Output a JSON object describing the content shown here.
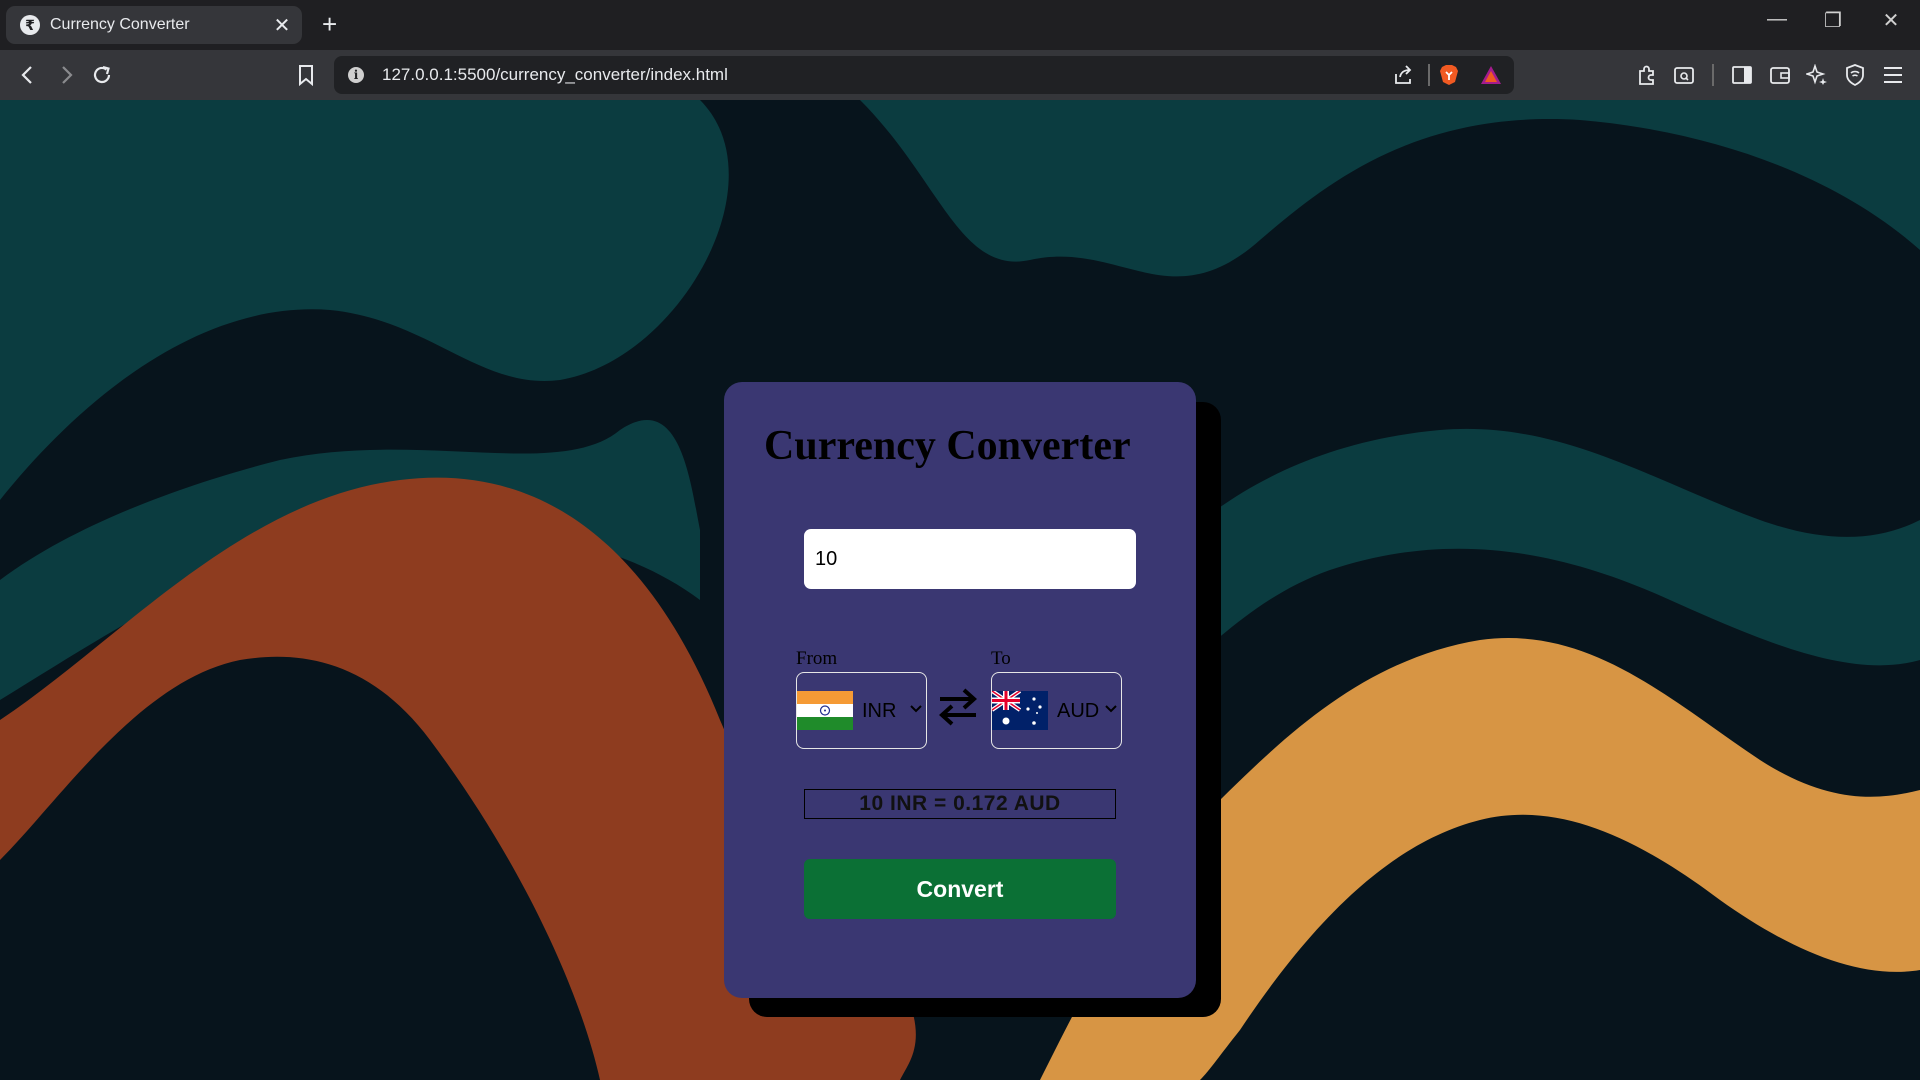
{
  "browser": {
    "tab": {
      "favicon_glyph": "₹",
      "title": "Currency Converter",
      "close_glyph": "✕"
    },
    "new_tab_glyph": "+",
    "window": {
      "minimize": "—",
      "restore": "❐",
      "close": "✕"
    },
    "address": {
      "url": "127.0.0.1:5500/currency_converter/index.html",
      "info_glyph": "i"
    },
    "icons": [
      "back-icon",
      "forward-icon",
      "reload-icon",
      "bookmark-icon",
      "share-icon",
      "brave-shield-icon",
      "brave-rewards-icon",
      "extensions-icon",
      "tab-search-icon",
      "sidebar-icon",
      "wallet-icon",
      "leo-ai-icon",
      "vpn-icon",
      "menu-icon"
    ]
  },
  "converter": {
    "title": "Currency Converter",
    "amount_value": "10",
    "from": {
      "label": "From",
      "currency": "INR",
      "flag": "india"
    },
    "to": {
      "label": "To",
      "currency": "AUD",
      "flag": "australia"
    },
    "swap_icon": "swap-arrows-icon",
    "result": "10 INR = 0.172 AUD",
    "convert_label": "Convert"
  },
  "colors": {
    "card": "#3a3772",
    "button": "#0b7035",
    "background": "#07141c",
    "wave_teal": "#0b3c40",
    "wave_orange": "#8e3c1f",
    "wave_yellow": "#d79544"
  }
}
